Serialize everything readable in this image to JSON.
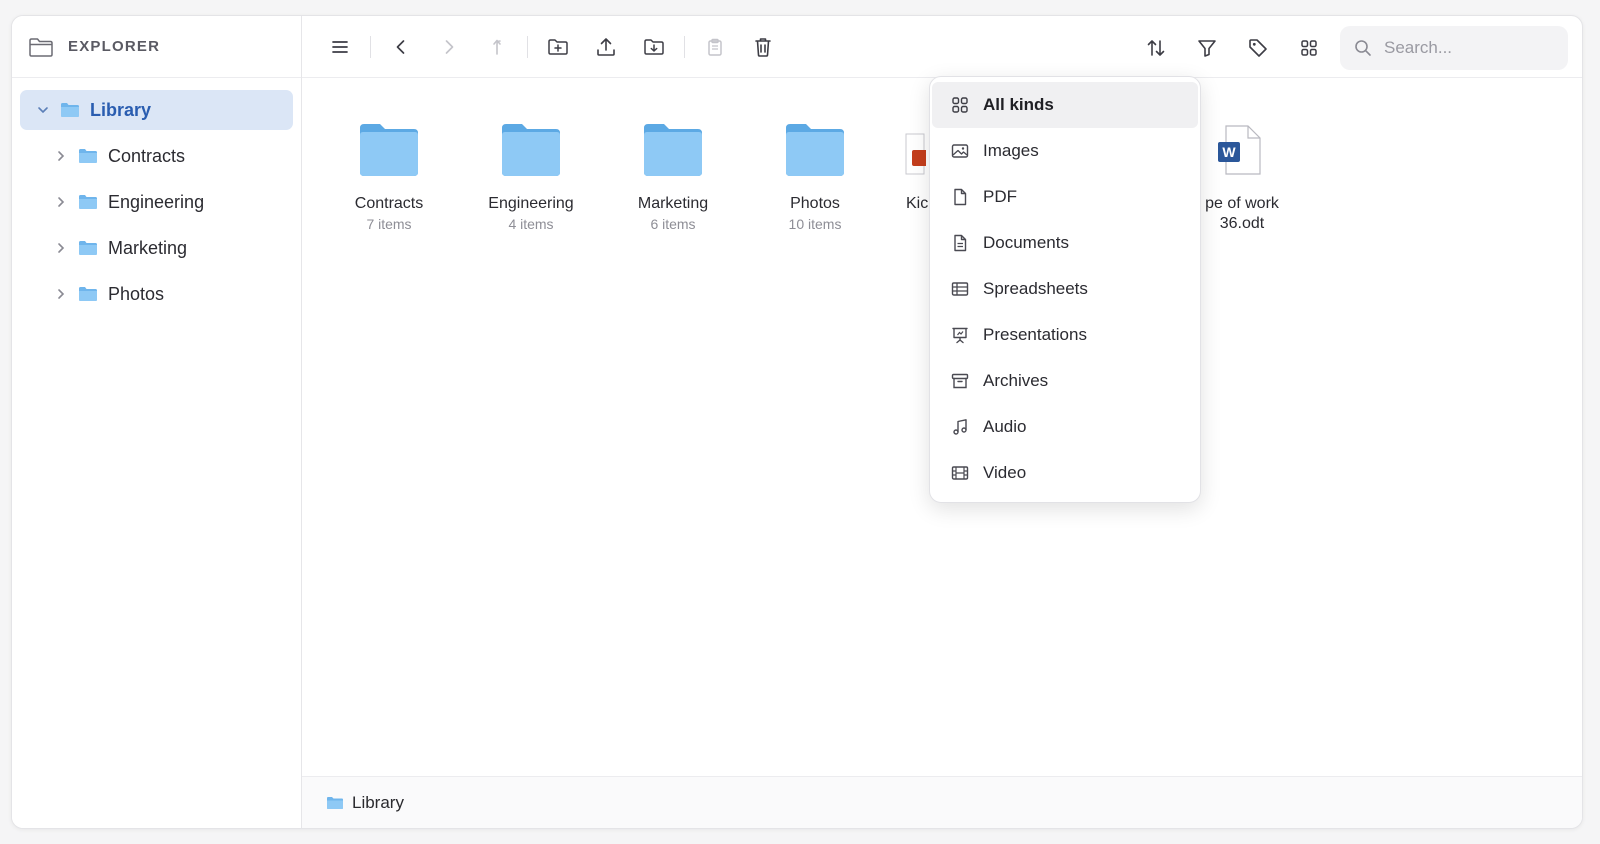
{
  "sidebar": {
    "title": "EXPLORER",
    "tree": [
      {
        "label": "Library",
        "expanded": true,
        "selected": true
      },
      {
        "label": "Contracts"
      },
      {
        "label": "Engineering"
      },
      {
        "label": "Marketing"
      },
      {
        "label": "Photos"
      }
    ]
  },
  "search": {
    "placeholder": "Search..."
  },
  "items": [
    {
      "name": "Contracts",
      "meta": "7 items",
      "kind": "folder"
    },
    {
      "name": "Engineering",
      "meta": "4 items",
      "kind": "folder"
    },
    {
      "name": "Marketing",
      "meta": "6 items",
      "kind": "folder"
    },
    {
      "name": "Photos",
      "meta": "10 items",
      "kind": "folder"
    },
    {
      "name": "Kick",
      "meta": "",
      "kind": "presentation"
    },
    {
      "name": "pe of work 36.odt",
      "meta": "",
      "kind": "word"
    }
  ],
  "menu": {
    "items": [
      {
        "label": "All kinds",
        "icon": "grid-icon",
        "active": true
      },
      {
        "label": "Images",
        "icon": "image-icon"
      },
      {
        "label": "PDF",
        "icon": "file-icon"
      },
      {
        "label": "Documents",
        "icon": "document-icon"
      },
      {
        "label": "Spreadsheets",
        "icon": "table-icon"
      },
      {
        "label": "Presentations",
        "icon": "presentation-icon"
      },
      {
        "label": "Archives",
        "icon": "archive-icon"
      },
      {
        "label": "Audio",
        "icon": "music-icon"
      },
      {
        "label": "Video",
        "icon": "film-icon"
      }
    ]
  },
  "status": {
    "path": "Library"
  },
  "colors": {
    "accent": "#2a5db0",
    "folder": "#8ec9f5",
    "word": "#2b579a",
    "ppt": "#c43e1c"
  }
}
